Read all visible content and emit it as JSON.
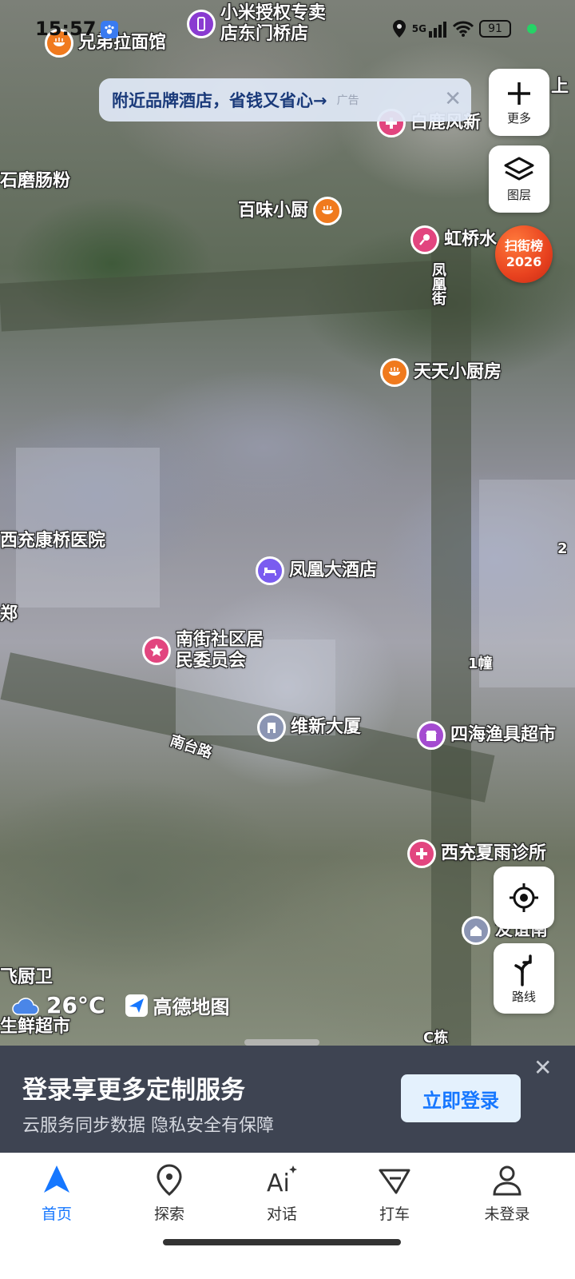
{
  "status_bar": {
    "time": "15:57",
    "network": "5G",
    "battery": "91"
  },
  "ad": {
    "text": "附近品牌酒店，省钱又省心→",
    "tag": "广告"
  },
  "controls": {
    "more_label": "更多",
    "layers_label": "图层",
    "route_label": "路线",
    "badge_line1": "扫街榜",
    "badge_line2": "2026"
  },
  "map": {
    "pois": [
      {
        "name": "兄弟拉面馆"
      },
      {
        "name": "小米授权专卖\n店东门桥店"
      },
      {
        "name": "白鹿风新"
      },
      {
        "name": "百味小厨"
      },
      {
        "name": "虹桥水"
      },
      {
        "name": "天天小厨房"
      },
      {
        "name": "凤凰大酒店"
      },
      {
        "name": "南街社区居\n民委员会"
      },
      {
        "name": "维新大厦"
      },
      {
        "name": "四海渔具超市"
      },
      {
        "name": "西充夏雨诊所"
      },
      {
        "name": "友谊南"
      }
    ],
    "labels": {
      "shimo": "石磨肠粉",
      "hospital": "西充康桥医院",
      "street_v": "凤凰街",
      "road": "南台路",
      "building1": "1幢",
      "feichu": "飞厨卫",
      "shengxian": "生鲜超市",
      "cdong": "C栋",
      "edge_bu": "郑",
      "edge_2": "2",
      "top_right_edge": "上"
    }
  },
  "weather": {
    "temp": "26°C",
    "brand": "高德地图"
  },
  "login": {
    "title": "登录享更多定制服务",
    "subtitle": "云服务同步数据 隐私安全有保障",
    "button": "立即登录"
  },
  "tabs": [
    {
      "label": "首页",
      "icon": "navigation-arrow-icon"
    },
    {
      "label": "探索",
      "icon": "location-pin-icon"
    },
    {
      "label": "对话",
      "icon": "ai-icon"
    },
    {
      "label": "打车",
      "icon": "taxi-icon"
    },
    {
      "label": "未登录",
      "icon": "user-icon"
    }
  ],
  "colors": {
    "accent": "#1677ff",
    "food": "#f07a1e",
    "pink": "#e2457f",
    "purple": "#8a3bd1",
    "hotel": "#7a5cf0",
    "office": "#8b95b3"
  }
}
